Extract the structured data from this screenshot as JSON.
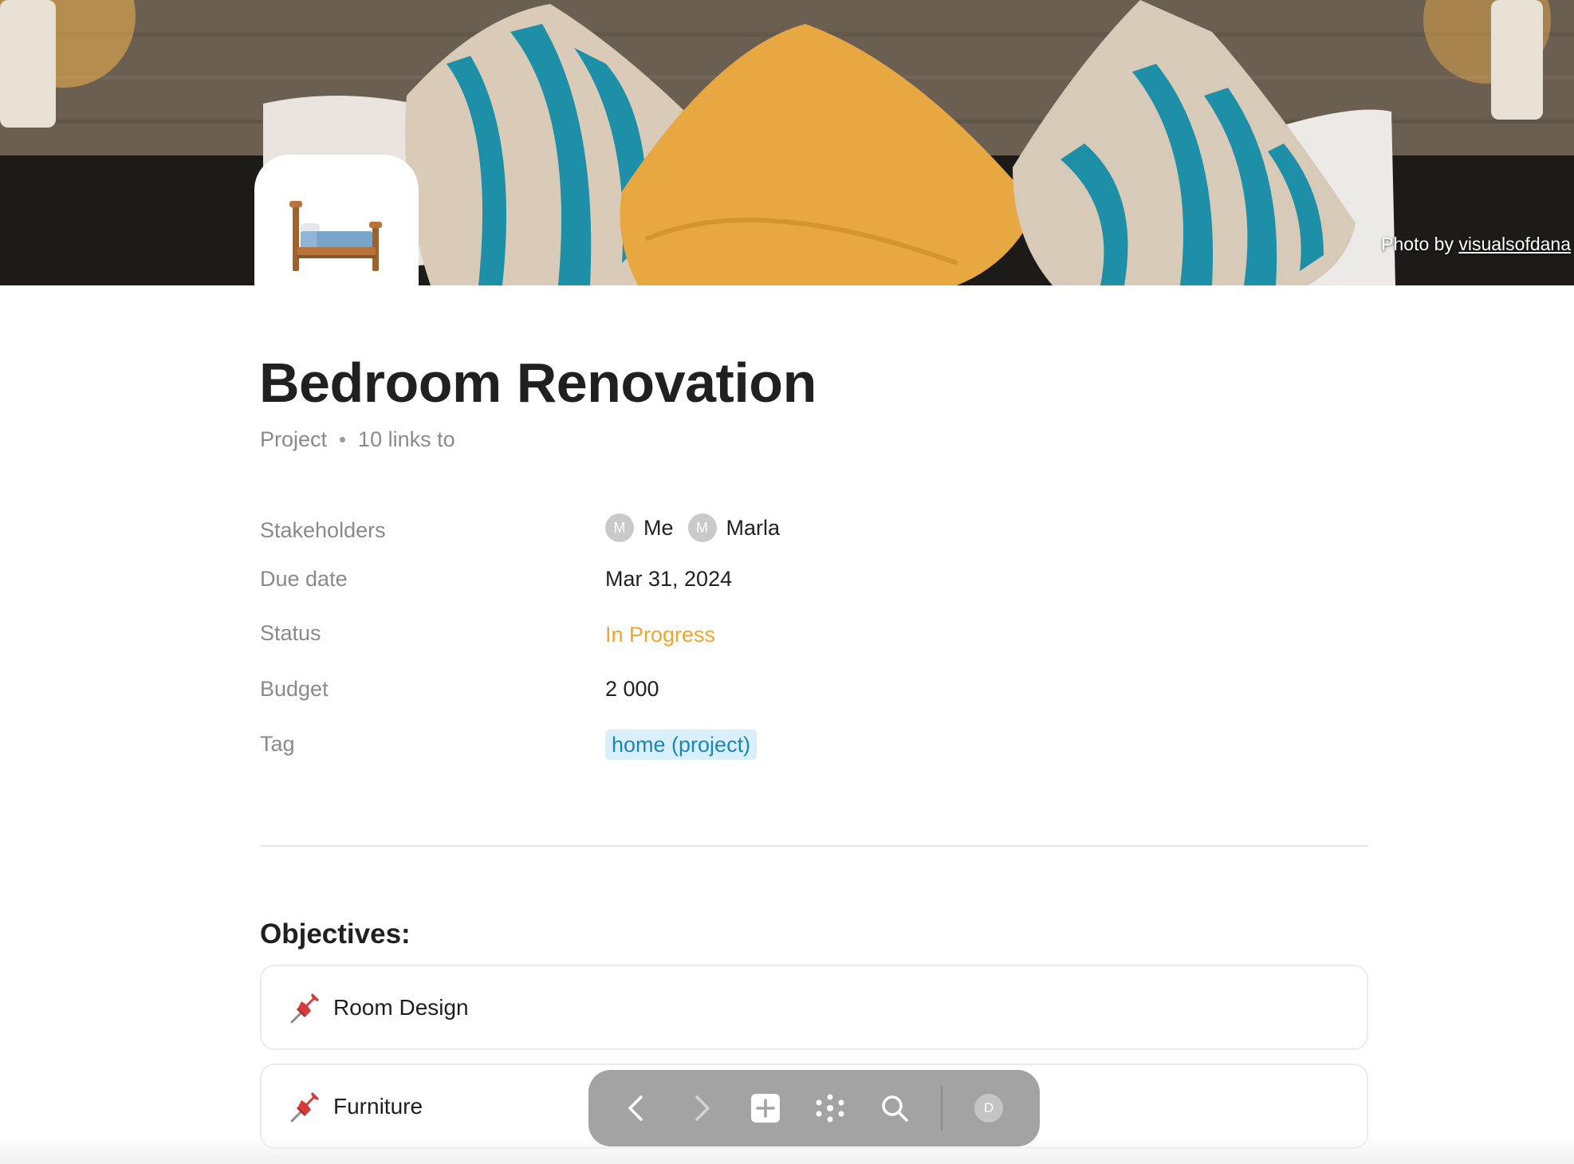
{
  "cover": {
    "credit_prefix": "Photo by",
    "credit_author": "visualsofdana"
  },
  "page": {
    "icon": "bed-icon",
    "title": "Bedroom Renovation",
    "type": "Project",
    "links": "10 links to"
  },
  "properties": {
    "stakeholders": {
      "label": "Stakeholders",
      "people": [
        {
          "initial": "M",
          "name": "Me"
        },
        {
          "initial": "M",
          "name": "Marla"
        }
      ]
    },
    "due_date": {
      "label": "Due date",
      "value": "Mar 31, 2024"
    },
    "status": {
      "label": "Status",
      "value": "In Progress",
      "color": "#f0a52c"
    },
    "budget": {
      "label": "Budget",
      "value": "2 000"
    },
    "tag": {
      "label": "Tag",
      "value": "home (project)",
      "color": "#1b86b8"
    }
  },
  "objectives": {
    "heading": "Objectives:",
    "items": [
      {
        "icon": "pushpin-icon",
        "label": "Room Design"
      },
      {
        "icon": "pushpin-icon",
        "label": "Furniture"
      }
    ]
  },
  "toolbar": {
    "buttons": [
      "back-icon",
      "forward-icon",
      "new-page-icon",
      "graph-icon",
      "search-icon"
    ],
    "user_initial": "D"
  }
}
